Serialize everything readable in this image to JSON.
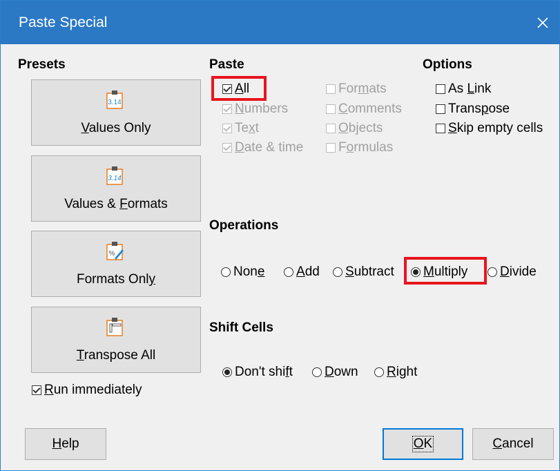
{
  "window": {
    "title": "Paste Special"
  },
  "presets": {
    "heading": "Presets",
    "items": [
      {
        "label": "Values Only",
        "icon": "clipboard-3-14-icon"
      },
      {
        "label": "Values & Formats",
        "icon": "clipboard-3-14-italic-icon"
      },
      {
        "label": "Formats Only",
        "icon": "clipboard-percent-brush-icon"
      },
      {
        "label": "Transpose All",
        "icon": "clipboard-grid-icon"
      }
    ],
    "run_immediately": {
      "label": "Run immediately",
      "checked": true
    }
  },
  "paste": {
    "heading": "Paste",
    "icon_text": "3.14",
    "icon_text_2": "%",
    "all": {
      "label": "All",
      "checked": true
    },
    "numbers": {
      "label": "Numbers",
      "checked": true,
      "enabled": false
    },
    "text": {
      "label": "Text",
      "checked": true,
      "enabled": false
    },
    "date_time": {
      "label": "Date & time",
      "checked": true,
      "enabled": false
    },
    "formats": {
      "label": "Formats",
      "checked": false,
      "enabled": false
    },
    "comments": {
      "label": "Comments",
      "checked": false,
      "enabled": false
    },
    "objects": {
      "label": "Objects",
      "checked": false,
      "enabled": false
    },
    "formulas": {
      "label": "Formulas",
      "checked": false,
      "enabled": false
    }
  },
  "options": {
    "heading": "Options",
    "as_link": {
      "label": "As Link",
      "checked": false
    },
    "transpose": {
      "label": "Transpose",
      "checked": false
    },
    "skip_empty": {
      "label": "Skip empty cells",
      "checked": false
    }
  },
  "operations": {
    "heading": "Operations",
    "none": "None",
    "add": "Add",
    "subtract": "Subtract",
    "multiply": "Multiply",
    "divide": "Divide",
    "selected": "Multiply"
  },
  "shift_cells": {
    "heading": "Shift Cells",
    "dont_shift": "Don't shift",
    "down": "Down",
    "right": "Right",
    "selected": "Don't shift"
  },
  "buttons": {
    "help": "Help",
    "ok": "OK",
    "cancel": "Cancel"
  },
  "colors": {
    "titlebar": "#2b78c5",
    "highlight": "#e8141e",
    "icon_orange": "#e67e22",
    "icon_blue": "#1e8bd0"
  }
}
